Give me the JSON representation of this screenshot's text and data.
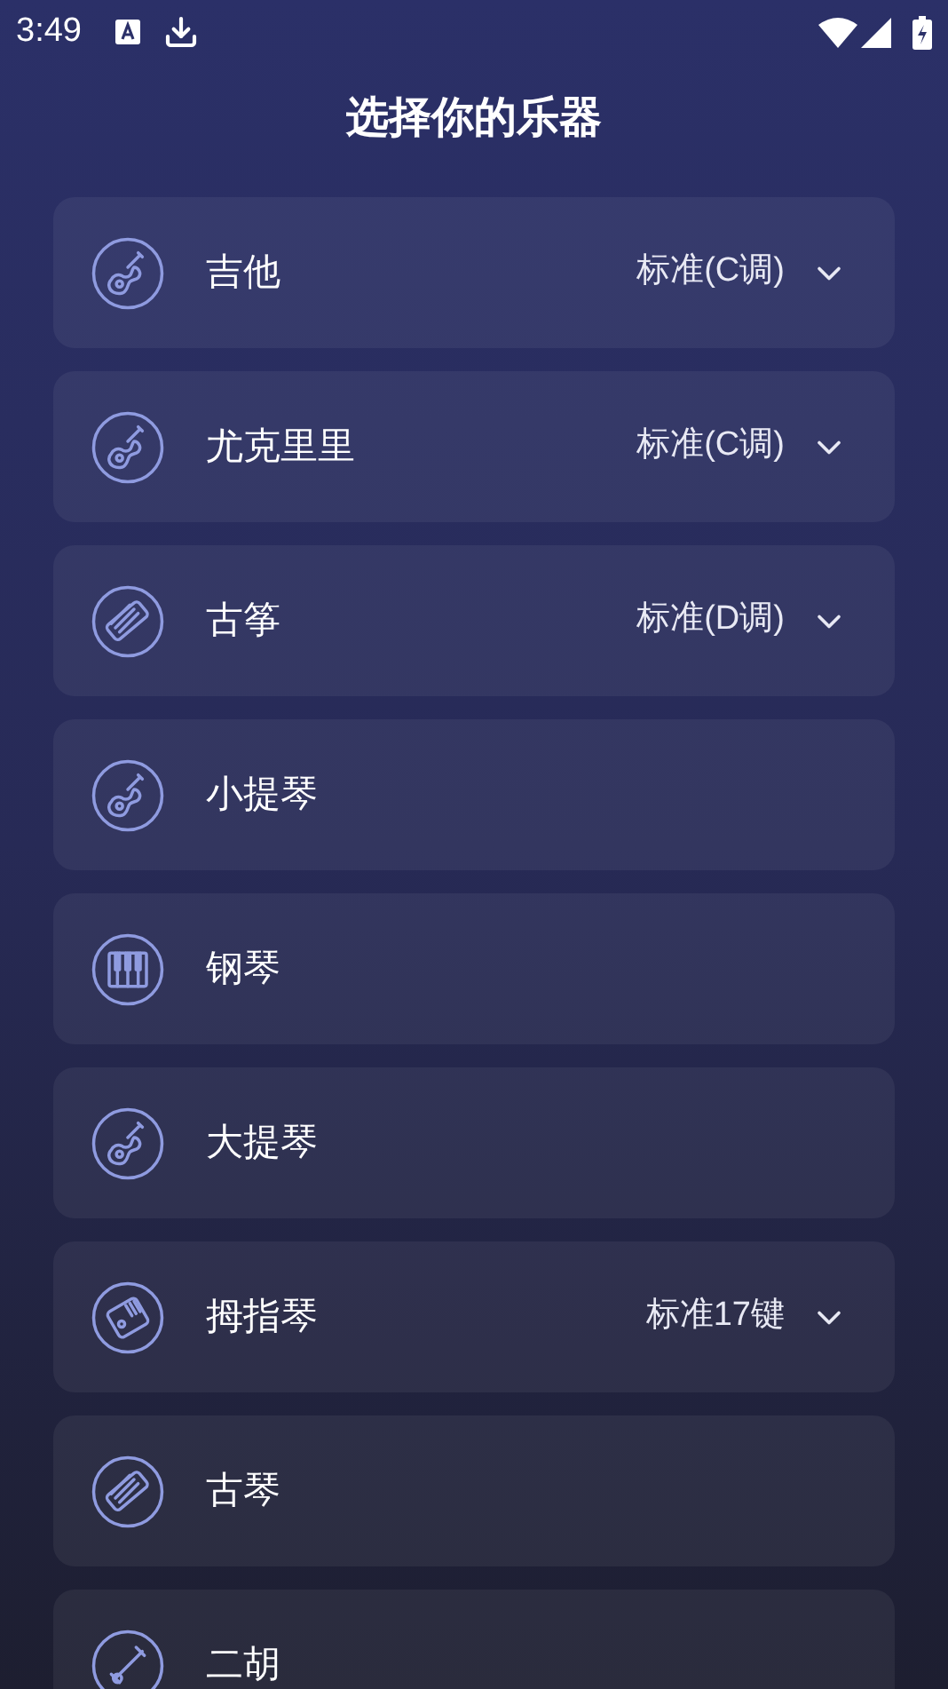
{
  "status_bar": {
    "time": "3:49"
  },
  "title": "选择你的乐器",
  "instruments": [
    {
      "name": "吉他",
      "kind": "guitar",
      "tuning": "标准(C调)"
    },
    {
      "name": "尤克里里",
      "kind": "guitar",
      "tuning": "标准(C调)"
    },
    {
      "name": "古筝",
      "kind": "zither",
      "tuning": "标准(D调)"
    },
    {
      "name": "小提琴",
      "kind": "guitar"
    },
    {
      "name": "钢琴",
      "kind": "piano"
    },
    {
      "name": "大提琴",
      "kind": "guitar"
    },
    {
      "name": "拇指琴",
      "kind": "kalimba",
      "tuning": "标准17键"
    },
    {
      "name": "古琴",
      "kind": "zither"
    },
    {
      "name": "二胡",
      "kind": "erhu"
    }
  ]
}
